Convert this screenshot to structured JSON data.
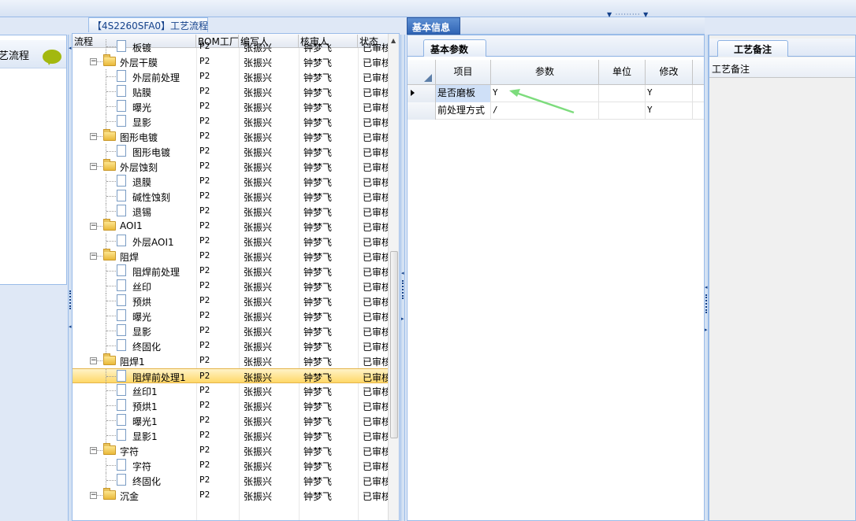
{
  "left_panel": {
    "item_label": "艺流程",
    "bubble_icon": "chat-bubble-icon"
  },
  "tree_panel": {
    "title": "【4S2260SFA0】工艺流程",
    "columns": [
      "流程",
      "BOM工厂",
      "编写人",
      "核审人",
      "状态"
    ],
    "rows": [
      {
        "level": 1,
        "type": "doc",
        "name": "板镀",
        "bom": "P2",
        "writer": "张振兴",
        "checker": "钟梦飞",
        "status": "已审核"
      },
      {
        "level": 0,
        "type": "folder",
        "name": "外层干膜",
        "bom": "P2",
        "writer": "张振兴",
        "checker": "钟梦飞",
        "status": "已审核"
      },
      {
        "level": 1,
        "type": "doc",
        "name": "外层前处理",
        "bom": "P2",
        "writer": "张振兴",
        "checker": "钟梦飞",
        "status": "已审核"
      },
      {
        "level": 1,
        "type": "doc",
        "name": "贴膜",
        "bom": "P2",
        "writer": "张振兴",
        "checker": "钟梦飞",
        "status": "已审核"
      },
      {
        "level": 1,
        "type": "doc",
        "name": "曝光",
        "bom": "P2",
        "writer": "张振兴",
        "checker": "钟梦飞",
        "status": "已审核"
      },
      {
        "level": 1,
        "type": "doc",
        "name": "显影",
        "bom": "P2",
        "writer": "张振兴",
        "checker": "钟梦飞",
        "status": "已审核"
      },
      {
        "level": 0,
        "type": "folder",
        "name": "图形电镀",
        "bom": "P2",
        "writer": "张振兴",
        "checker": "钟梦飞",
        "status": "已审核"
      },
      {
        "level": 1,
        "type": "doc",
        "name": "图形电镀",
        "bom": "P2",
        "writer": "张振兴",
        "checker": "钟梦飞",
        "status": "已审核"
      },
      {
        "level": 0,
        "type": "folder",
        "name": "外层蚀刻",
        "bom": "P2",
        "writer": "张振兴",
        "checker": "钟梦飞",
        "status": "已审核"
      },
      {
        "level": 1,
        "type": "doc",
        "name": "退膜",
        "bom": "P2",
        "writer": "张振兴",
        "checker": "钟梦飞",
        "status": "已审核"
      },
      {
        "level": 1,
        "type": "doc",
        "name": "碱性蚀刻",
        "bom": "P2",
        "writer": "张振兴",
        "checker": "钟梦飞",
        "status": "已审核"
      },
      {
        "level": 1,
        "type": "doc",
        "name": "退锡",
        "bom": "P2",
        "writer": "张振兴",
        "checker": "钟梦飞",
        "status": "已审核"
      },
      {
        "level": 0,
        "type": "folder",
        "name": "AOI1",
        "bom": "P2",
        "writer": "张振兴",
        "checker": "钟梦飞",
        "status": "已审核"
      },
      {
        "level": 1,
        "type": "doc",
        "name": "外层AOI1",
        "bom": "P2",
        "writer": "张振兴",
        "checker": "钟梦飞",
        "status": "已审核"
      },
      {
        "level": 0,
        "type": "folder",
        "name": "阻焊",
        "bom": "P2",
        "writer": "张振兴",
        "checker": "钟梦飞",
        "status": "已审核"
      },
      {
        "level": 1,
        "type": "doc",
        "name": "阻焊前处理",
        "bom": "P2",
        "writer": "张振兴",
        "checker": "钟梦飞",
        "status": "已审核"
      },
      {
        "level": 1,
        "type": "doc",
        "name": "丝印",
        "bom": "P2",
        "writer": "张振兴",
        "checker": "钟梦飞",
        "status": "已审核"
      },
      {
        "level": 1,
        "type": "doc",
        "name": "预烘",
        "bom": "P2",
        "writer": "张振兴",
        "checker": "钟梦飞",
        "status": "已审核"
      },
      {
        "level": 1,
        "type": "doc",
        "name": "曝光",
        "bom": "P2",
        "writer": "张振兴",
        "checker": "钟梦飞",
        "status": "已审核"
      },
      {
        "level": 1,
        "type": "doc",
        "name": "显影",
        "bom": "P2",
        "writer": "张振兴",
        "checker": "钟梦飞",
        "status": "已审核"
      },
      {
        "level": 1,
        "type": "doc",
        "name": "终固化",
        "bom": "P2",
        "writer": "张振兴",
        "checker": "钟梦飞",
        "status": "已审核"
      },
      {
        "level": 0,
        "type": "folder",
        "name": "阻焊1",
        "bom": "P2",
        "writer": "张振兴",
        "checker": "钟梦飞",
        "status": "已审核"
      },
      {
        "level": 1,
        "type": "doc",
        "name": "阻焊前处理1",
        "bom": "P2",
        "writer": "张振兴",
        "checker": "钟梦飞",
        "status": "已审核",
        "selected": true
      },
      {
        "level": 1,
        "type": "doc",
        "name": "丝印1",
        "bom": "P2",
        "writer": "张振兴",
        "checker": "钟梦飞",
        "status": "已审核"
      },
      {
        "level": 1,
        "type": "doc",
        "name": "预烘1",
        "bom": "P2",
        "writer": "张振兴",
        "checker": "钟梦飞",
        "status": "已审核"
      },
      {
        "level": 1,
        "type": "doc",
        "name": "曝光1",
        "bom": "P2",
        "writer": "张振兴",
        "checker": "钟梦飞",
        "status": "已审核"
      },
      {
        "level": 1,
        "type": "doc",
        "name": "显影1",
        "bom": "P2",
        "writer": "张振兴",
        "checker": "钟梦飞",
        "status": "已审核"
      },
      {
        "level": 0,
        "type": "folder",
        "name": "字符",
        "bom": "P2",
        "writer": "张振兴",
        "checker": "钟梦飞",
        "status": "已审核"
      },
      {
        "level": 1,
        "type": "doc",
        "name": "字符",
        "bom": "P2",
        "writer": "张振兴",
        "checker": "钟梦飞",
        "status": "已审核"
      },
      {
        "level": 1,
        "type": "doc",
        "name": "终固化",
        "bom": "P2",
        "writer": "张振兴",
        "checker": "钟梦飞",
        "status": "已审核"
      },
      {
        "level": 0,
        "type": "folder",
        "name": "沉金",
        "bom": "P2",
        "writer": "张振兴",
        "checker": "钟梦飞",
        "status": "已审核"
      }
    ]
  },
  "basic_info": {
    "tab_label": "基本信息",
    "subtab_label": "基本参数",
    "columns": [
      "项目",
      "参数",
      "单位",
      "修改"
    ],
    "rows": [
      {
        "item": "是否磨板",
        "param": "Y",
        "unit": "",
        "modify": "Y",
        "current": true
      },
      {
        "item": "前处理方式",
        "param": "/",
        "unit": "",
        "modify": "Y",
        "current": false
      }
    ],
    "annotation_color": "#7ddc7d"
  },
  "process_notes": {
    "tab_label": "工艺备注",
    "field_label": "工艺备注"
  },
  "colors": {
    "accent": "#2f64b5",
    "border": "#99bbe8",
    "selection": "#ffd868"
  }
}
